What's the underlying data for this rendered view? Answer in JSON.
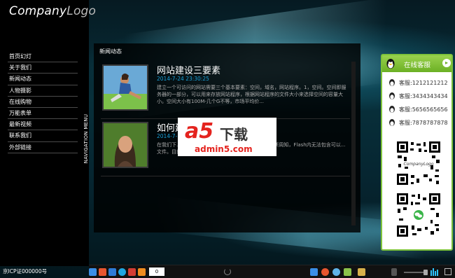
{
  "logo": {
    "company": "Company",
    "logo": "Logo"
  },
  "menu": [
    {
      "label": "首页幻灯"
    },
    {
      "label": "关于我们"
    },
    {
      "label": "新闻动态"
    },
    {
      "label": "人物摄影"
    },
    {
      "label": "在线购物"
    },
    {
      "label": "万能表单"
    },
    {
      "label": "最新视频"
    },
    {
      "label": "联系我们"
    },
    {
      "label": "外部链接"
    }
  ],
  "nav_vertical_label": "NAVIGATION MENU",
  "icp": "京ICP证000000号",
  "panel": {
    "title": "新闻动态",
    "news": [
      {
        "title": "网站建设三要素",
        "date": "2014-7-24 23:30:25",
        "excerpt": "建立一个可访问的网站需要三个基本要素：空间，域名，网站程序。1，空间。空间即服务器的一部分，可以用来存放网站程序，根据网站程序的文件大小来选择空间的容量大小。空间大小有100M-几个G不等，市场平均价..."
      },
      {
        "title": "如何建",
        "date": "2014-7-",
        "excerpt": "在我们下...的静态网站或动态网站，但是如果说起...众所周知，Flash内无法包含可以...文件。目前..."
      }
    ]
  },
  "watermark": {
    "a5": "a5",
    "download": "下载",
    "url": "admin5.com"
  },
  "service": {
    "title": "在线客服",
    "contacts": [
      {
        "label": "客服:1212121212"
      },
      {
        "label": "客服:3434343434"
      },
      {
        "label": "客服:5656565656"
      },
      {
        "label": "客服:7878787878"
      }
    ],
    "qr_caption": "CompanyLogo"
  },
  "taskbar": {
    "counter": "0"
  },
  "colors": {
    "accent_green": "#7dc23a",
    "date_blue": "#19a0d8",
    "watermark_red": "#e4231e"
  }
}
